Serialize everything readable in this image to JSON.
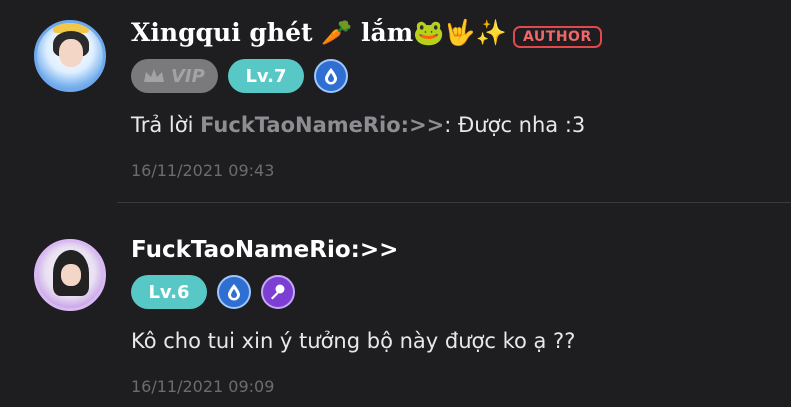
{
  "comments": [
    {
      "username": "Xingqui ghét 🥕 lắm🐸🤟✨",
      "author_label": "AUTHOR",
      "vip_label": "VIP",
      "level": "Lv.7",
      "reply_prefix": "Trả lời ",
      "reply_mention": "FuckTaoNameRio:>>",
      "reply_text": ": Được nha :3",
      "timestamp": "16/11/2021 09:43",
      "badge_icons": [
        "crown-icon",
        "water-drop-icon"
      ]
    },
    {
      "username": "FuckTaoNameRio:>>",
      "level": "Lv.6",
      "message": "Kô cho tui xin ý tưởng bộ này được ko ạ ??",
      "timestamp": "16/11/2021 09:09",
      "badge_icons": [
        "water-drop-icon",
        "microphone-icon"
      ]
    }
  ],
  "colors": {
    "background": "#1e1e20",
    "level_badge": "#58c8c6",
    "author_badge": "#e0484b",
    "mention": "#8d8d92",
    "timestamp": "#6c6c70"
  }
}
